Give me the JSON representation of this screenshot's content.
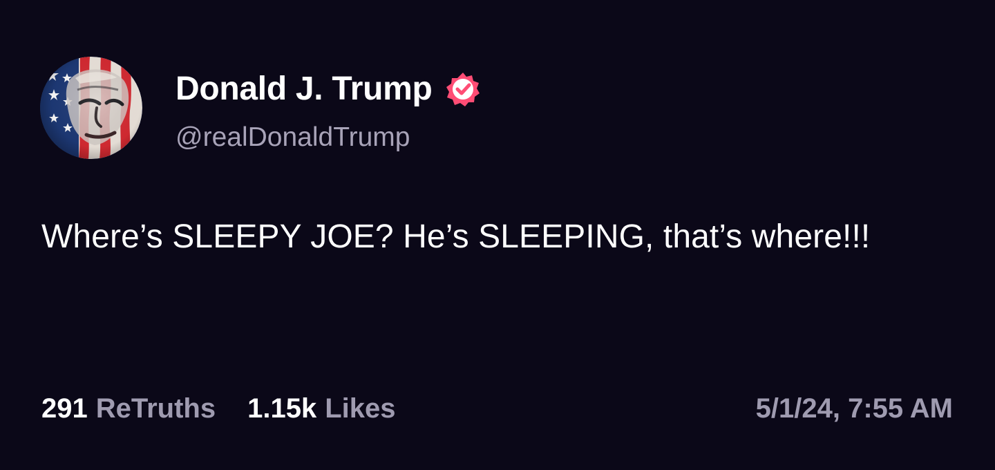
{
  "post": {
    "author": {
      "display_name": "Donald J. Trump",
      "handle": "@realDonaldTrump",
      "verified_icon": "verified-badge-icon",
      "avatar_icon": "american-flag-portrait-avatar"
    },
    "text": "Where’s SLEEPY JOE? He’s SLEEPING, that’s where!!!",
    "stats": {
      "retruths_count": "291",
      "retruths_label": "ReTruths",
      "likes_count": "1.15k",
      "likes_label": "Likes"
    },
    "timestamp": "5/1/24, 7:55 AM"
  },
  "colors": {
    "background": "#0b0818",
    "primary_text": "#ffffff",
    "secondary_text": "#9f9bb0",
    "verified_badge": "#ff4d75"
  }
}
